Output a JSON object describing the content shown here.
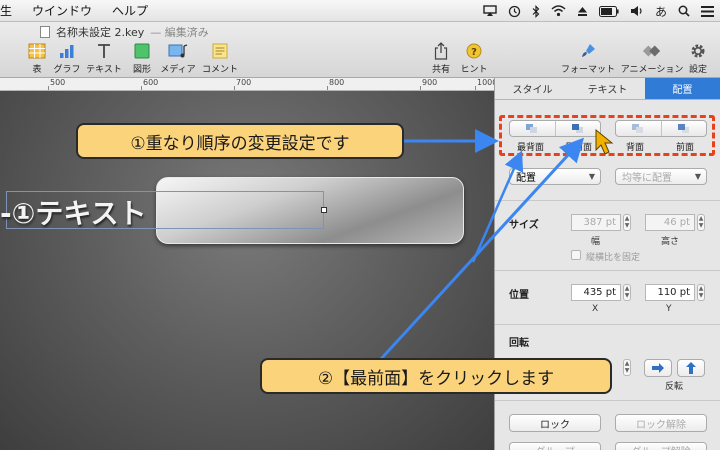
{
  "menubar": {
    "items": [
      "生",
      "ウインドウ",
      "ヘルプ"
    ],
    "ime": "あ"
  },
  "window": {
    "title": "名称未設定 2.key",
    "edited": "— 編集済み"
  },
  "toolbar": {
    "table": "表",
    "chart": "グラフ",
    "text": "テキスト",
    "shape": "図形",
    "media": "メディア",
    "comment": "コメント",
    "share": "共有",
    "hint": "ヒント",
    "format": "フォーマット",
    "animation": "アニメーション",
    "settings": "設定"
  },
  "ruler": {
    "marks": [
      "500",
      "600",
      "700",
      "800",
      "900",
      "1000"
    ]
  },
  "canvas": {
    "text": "-①テキスト"
  },
  "inspector": {
    "tabs": [
      "スタイル",
      "テキスト",
      "配置"
    ],
    "arrange": {
      "to_front_most": "最背面",
      "to_front": "最前面",
      "back": "背面",
      "front": "前面"
    },
    "align_label": "配置",
    "distribute_label": "均等に配置",
    "size": {
      "label": "サイズ",
      "width": "387 pt",
      "height": "46 pt",
      "width_label": "幅",
      "height_label": "高さ",
      "constrain": "縦横比を固定"
    },
    "position": {
      "label": "位置",
      "x": "435 pt",
      "y": "110 pt",
      "x_label": "X",
      "y_label": "Y"
    },
    "rotate": {
      "label": "回転",
      "flip_label": "反転"
    },
    "lock": "ロック",
    "unlock": "ロック解除",
    "group": "グループ",
    "ungroup": "グループ解除"
  },
  "annotations": {
    "callout1": "①重なり順序の変更設定です",
    "callout2": "②【最前面】をクリックします"
  },
  "colors": {
    "accent": "#2f7bd6",
    "callout_fill": "#fbd37b",
    "highlight": "#e8421d"
  }
}
